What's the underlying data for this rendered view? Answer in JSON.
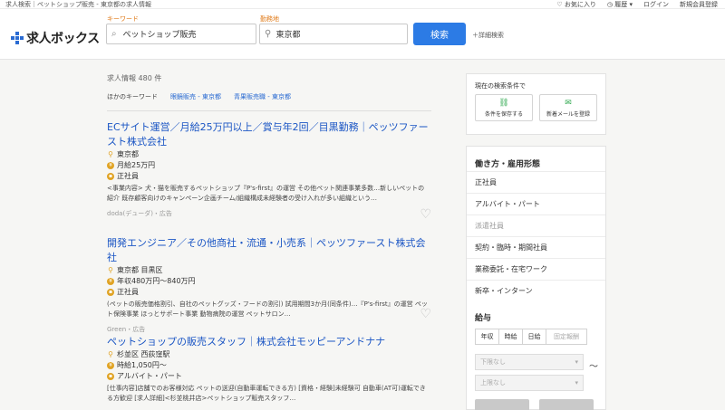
{
  "topbar": {
    "breadcrumb": "求人検索｜ペットショップ販売 - 東京都の求人情報",
    "favorites": "♡ お気に入り",
    "history": "履歴",
    "login": "ログイン",
    "register": "新規会員登録"
  },
  "header": {
    "logo_text": "求人ボックス",
    "keyword_label": "キーワード",
    "keyword_value": "ペットショップ販売",
    "location_label": "勤務地",
    "location_value": "東京都",
    "search_button": "検索",
    "detail_search": "＋詳細検索"
  },
  "results": {
    "count": "求人情報 480 件",
    "other_keywords_label": "ほかのキーワード",
    "other_keywords": [
      "眼鏡販売 - 東京都",
      "青果販売職 - 東京都"
    ]
  },
  "jobs": [
    {
      "title": "ECサイト運営／月給25万円以上／賞与年2回／目黒勤務｜ペッツファースト株式会社",
      "location": "東京都",
      "salary": "月給25万円",
      "employment": "正社員",
      "description": "<事業内容> 犬・猫を販売するペットショップ『P's-first』の運営 その他ペット関連事業多数…新しいペットの紹介 既存顧客向けのキャンペーン企画チーム/組織構成未経験者の受け入れが多い組織という…",
      "source": "doda(デューダ)・広告"
    },
    {
      "title": "開発エンジニア／その他商社・流通・小売系｜ペッツファースト株式会社",
      "location": "東京都 目黒区",
      "salary": "年収480万円〜840万円",
      "employment": "正社員",
      "description": "(ペットの販売価格割引、自社のペットグッズ・フードの割引) 試用期間3か月(同条件)…『P's-first』の運営 ペット保険事業 ほっとサポート事業 動物病院の運営 ペットサロン…",
      "source": "Green・広告"
    },
    {
      "title": "ペットショップの販売スタッフ｜株式会社モッピーアンドナナ",
      "location": "杉並区 西荻窪駅",
      "salary": "時給1,050円〜",
      "employment": "アルバイト・パート",
      "description": "[仕事内容]店舗でのお客様対応 ペットの送迎(自動車運転できる方) [資格・経験]未経験可 自動車(AT可)運転できる方歓迎 [求人詳細]<杉並桃井店>ペットショップ販売スタッフ…",
      "source": ""
    }
  ],
  "sidebar": {
    "conditions_title": "現在の検索条件で",
    "save_conditions": "条件を保存する",
    "new_mail": "新着メールを登録",
    "work_title": "働き方・雇用形態",
    "work_items": [
      "正社員",
      "アルバイト・パート",
      "派遣社員",
      "契約・臨時・期間社員",
      "業務委託・在宅ワーク",
      "新卒・インターン"
    ],
    "salary_title": "給与",
    "salary_tabs": [
      "年収",
      "時給",
      "日給",
      "固定報酬"
    ],
    "lower_placeholder": "下限なし",
    "upper_placeholder": "上限なし",
    "tilde": "〜"
  }
}
